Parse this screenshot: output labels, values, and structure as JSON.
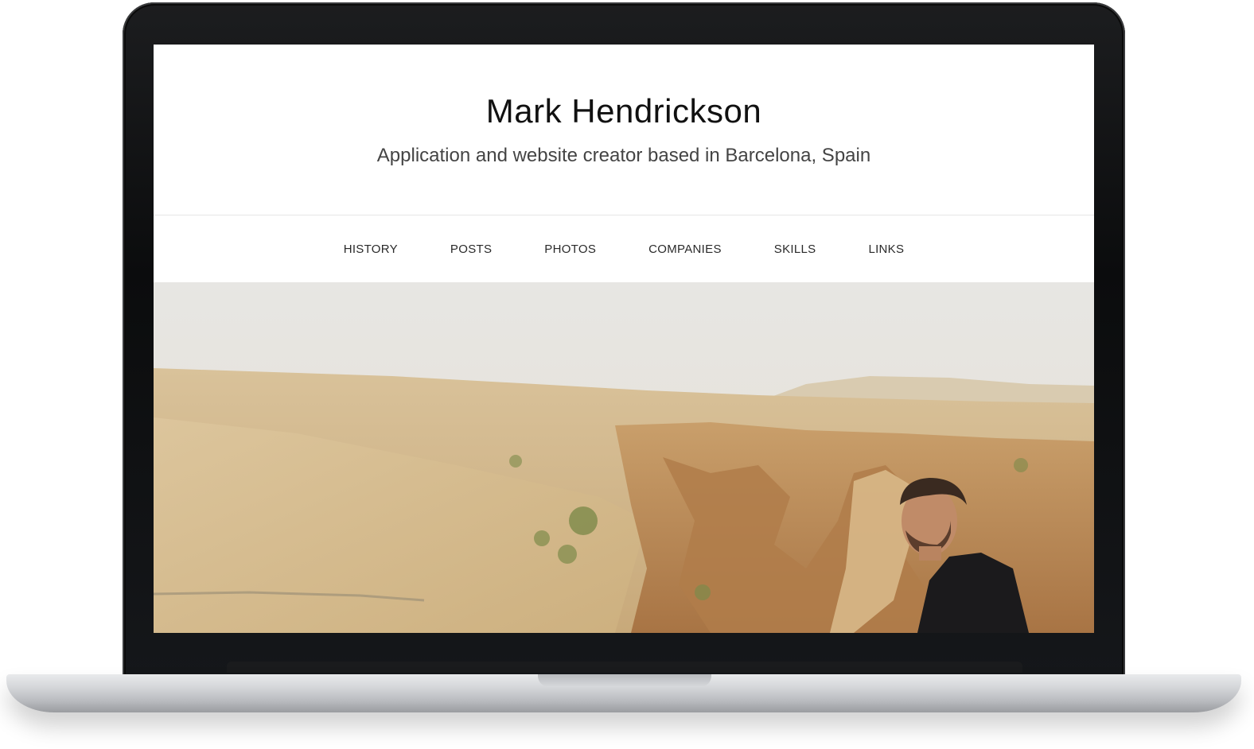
{
  "site": {
    "title": "Mark Hendrickson",
    "subtitle": "Application and website creator based in Barcelona, Spain"
  },
  "nav": {
    "items": [
      {
        "label": "HISTORY"
      },
      {
        "label": "POSTS"
      },
      {
        "label": "PHOTOS"
      },
      {
        "label": "COMPANIES"
      },
      {
        "label": "SKILLS"
      },
      {
        "label": "LINKS"
      }
    ]
  },
  "colors": {
    "text": "#111111",
    "subtitle": "#444444",
    "sky": "#e8e6e2",
    "desert": "#cfb082"
  }
}
